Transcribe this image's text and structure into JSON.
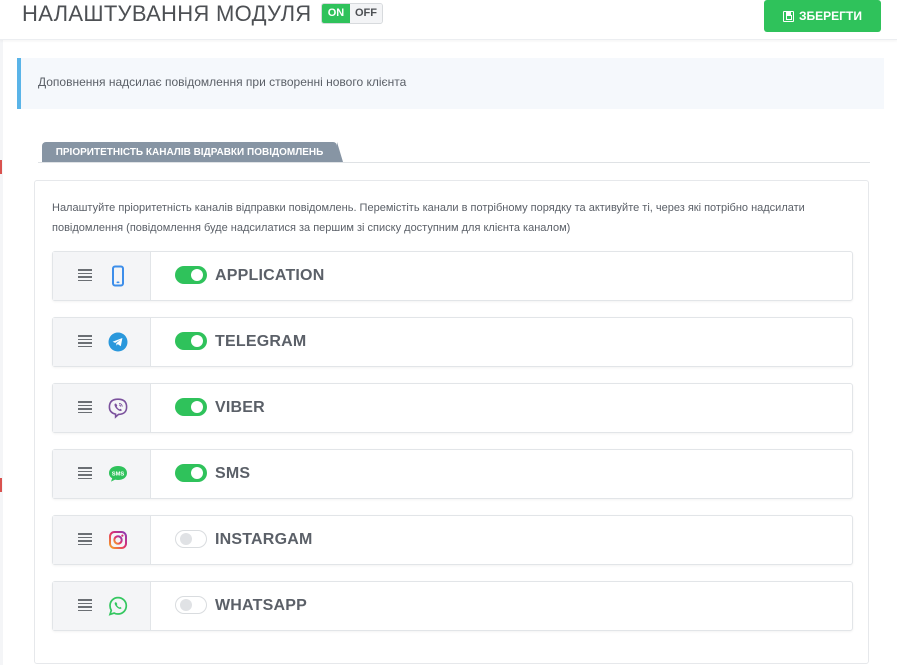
{
  "header": {
    "title": "НАЛАШТУВАННЯ МОДУЛЯ",
    "toggle_on": "ON",
    "toggle_off": "OFF",
    "save_label": "ЗБЕРЕГТИ"
  },
  "info": {
    "text": "Доповнення надсилає повідомлення при створенні нового клієнта"
  },
  "tab": {
    "label": "ПРІОРИТЕТНІСТЬ КАНАЛІВ ВІДРАВКИ ПОВІДОМЛЕНЬ"
  },
  "panel": {
    "description": "Налаштуйте пріоритетність каналів відправки повідомлень. Перемістіть канали в потрібному порядку та активуйте ті, через які потрібно надсилати повідомлення (повідомлення буде надсилатися за першим зі списку доступним для клієнта каналом)"
  },
  "channels": [
    {
      "name": "APPLICATION",
      "enabled": true,
      "icon": "mobile-phone-icon",
      "color": "#3d8eea"
    },
    {
      "name": "TELEGRAM",
      "enabled": true,
      "icon": "telegram-icon",
      "color": "#2a98dc"
    },
    {
      "name": "VIBER",
      "enabled": true,
      "icon": "viber-icon",
      "color": "#7b519d"
    },
    {
      "name": "SMS",
      "enabled": true,
      "icon": "sms-icon",
      "color": "#2fc25b"
    },
    {
      "name": "INSTARGAM",
      "enabled": false,
      "icon": "instagram-icon",
      "color": "#d6306f"
    },
    {
      "name": "WHATSAPP",
      "enabled": false,
      "icon": "whatsapp-icon",
      "color": "#34c760"
    }
  ],
  "colors": {
    "accent_green": "#2fc25b",
    "info_border": "#5ab4e8",
    "tab_background": "#8795a4"
  }
}
